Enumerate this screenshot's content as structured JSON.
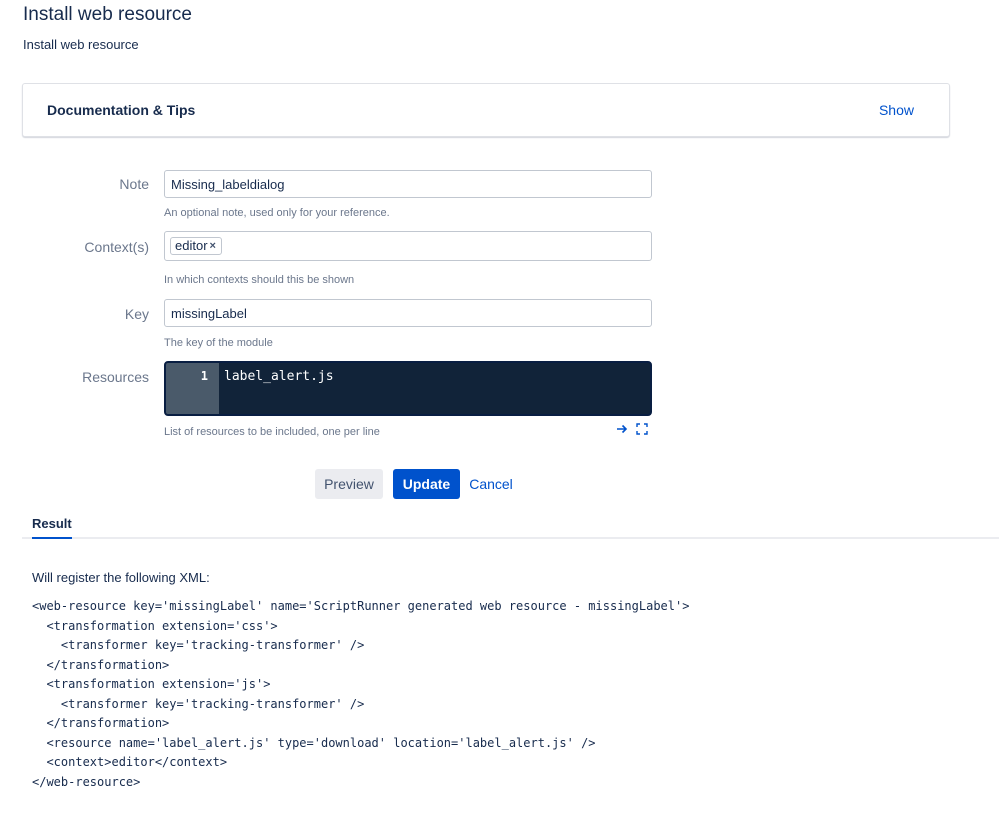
{
  "page": {
    "title": "Install web resource",
    "subtitle": "Install web resource"
  },
  "docs_panel": {
    "title": "Documentation & Tips",
    "toggle_label": "Show"
  },
  "form": {
    "note": {
      "label": "Note",
      "value": "Missing_labeldialog",
      "help": "An optional note, used only for your reference."
    },
    "contexts": {
      "label": "Context(s)",
      "chips": [
        "editor"
      ],
      "help": "In which contexts should this be shown"
    },
    "key": {
      "label": "Key",
      "value": "missingLabel",
      "help": "The key of the module"
    },
    "resources": {
      "label": "Resources",
      "line_numbers": [
        "1"
      ],
      "lines": [
        "label_alert.js"
      ],
      "help": "List of resources to be included, one per line",
      "tools": [
        "arrow-right-icon",
        "fullscreen-icon"
      ]
    }
  },
  "buttons": {
    "preview": "Preview",
    "update": "Update",
    "cancel": "Cancel"
  },
  "tabs": {
    "result": "Result"
  },
  "result": {
    "intro": "Will register the following XML:",
    "xml_lines": [
      "<web-resource key='missingLabel' name='ScriptRunner generated web resource - missingLabel'>",
      "  <transformation extension='css'>",
      "    <transformer key='tracking-transformer' />",
      "  </transformation>",
      "  <transformation extension='js'>",
      "    <transformer key='tracking-transformer' />",
      "  </transformation>",
      "  <resource name='label_alert.js' type='download' location='label_alert.js' />",
      "  <context>editor</context>",
      "</web-resource>"
    ]
  },
  "colors": {
    "accent": "#0052cc",
    "editor_bg": "#112339",
    "text": "#172b4d",
    "muted": "#6b778c"
  }
}
